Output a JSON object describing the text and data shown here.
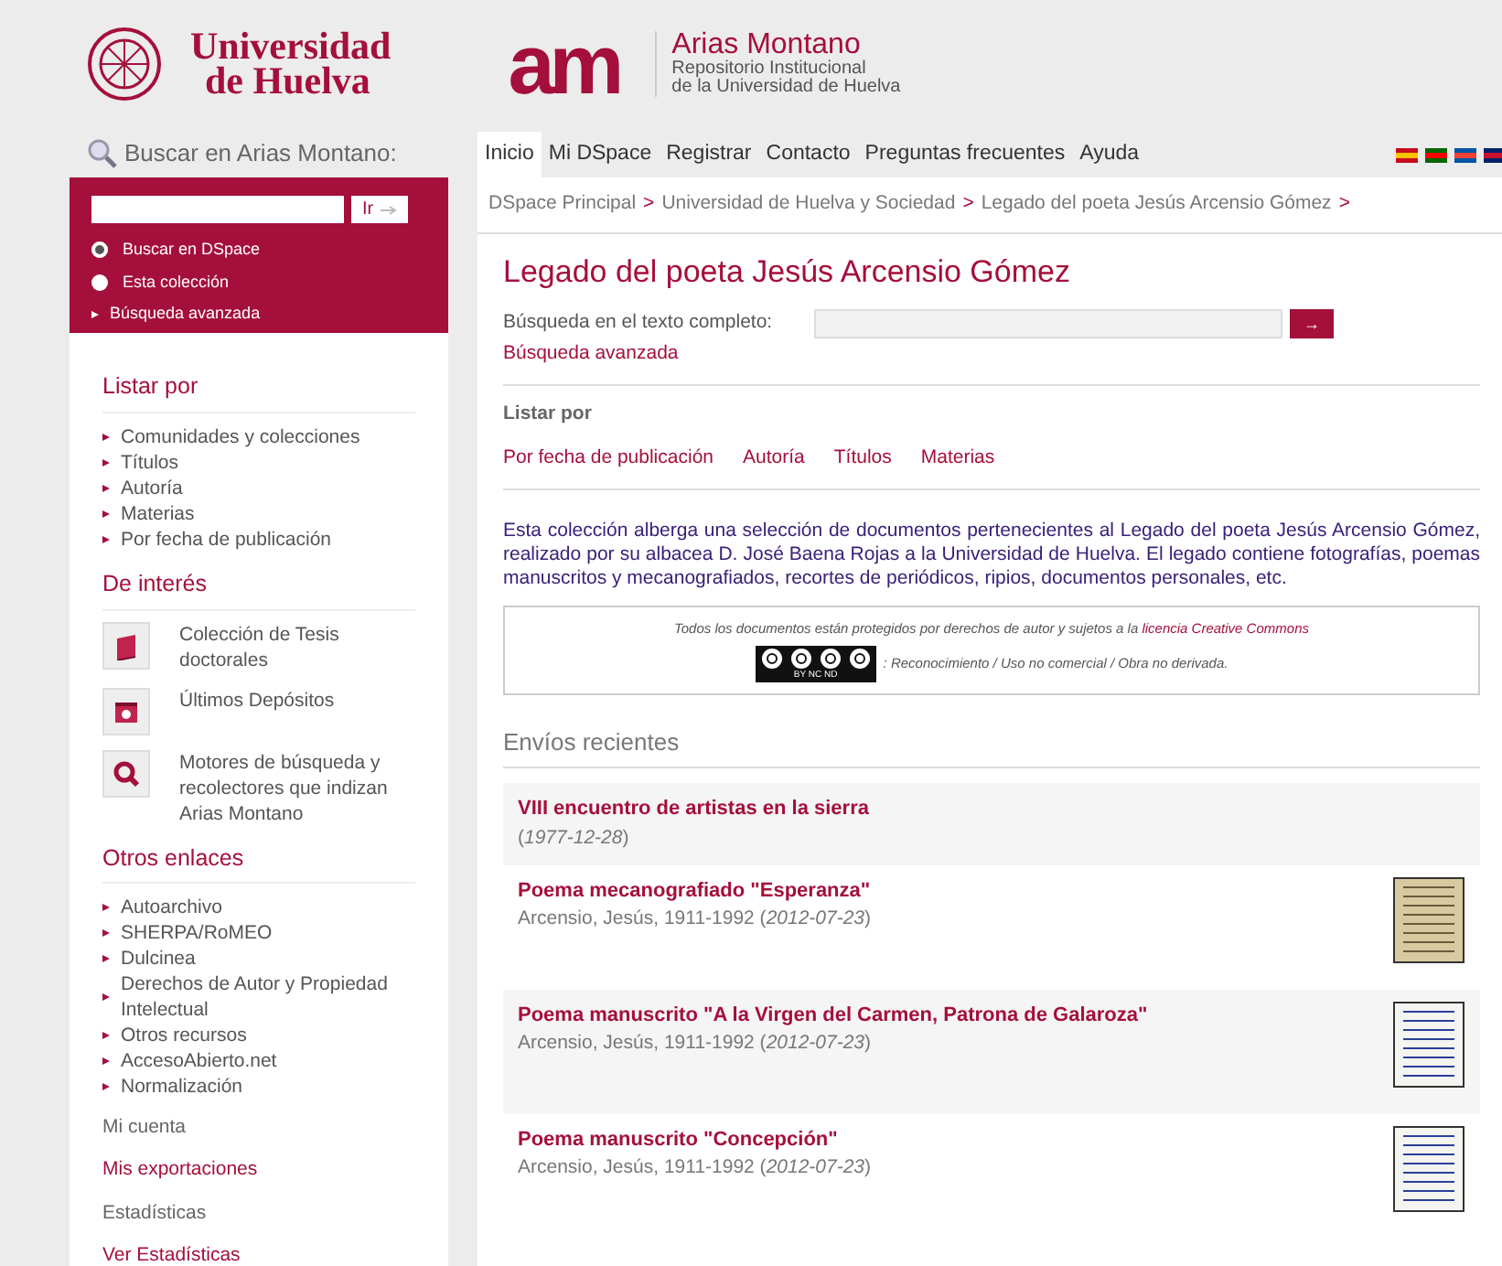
{
  "header": {
    "university": {
      "line1": "Universidad",
      "line2": "de Huelva"
    },
    "repository": {
      "logo_text": "am",
      "name": "Arias Montano",
      "subtitle1": "Repositorio Institucional",
      "subtitle2": "de la Universidad de Huelva"
    }
  },
  "sidebar_search": {
    "title": "Buscar en Arias Montano:",
    "button": "Ir",
    "scopes": [
      {
        "label": "Buscar en DSpace",
        "selected": true
      },
      {
        "label": "Esta colección",
        "selected": false
      }
    ],
    "advanced": "Búsqueda avanzada"
  },
  "nav": {
    "tabs": [
      {
        "label": "Inicio",
        "selected": true
      },
      {
        "label": "Mi DSpace",
        "selected": false
      },
      {
        "label": "Registrar",
        "selected": false
      },
      {
        "label": "Contacto",
        "selected": false
      },
      {
        "label": "Preguntas frecuentes",
        "selected": false
      },
      {
        "label": "Ayuda",
        "selected": false
      }
    ]
  },
  "sidebar": {
    "browse": {
      "title": "Listar por",
      "items": [
        "Comunidades y colecciones",
        "Títulos",
        "Autoría",
        "Materias",
        "Por fecha de publicación"
      ]
    },
    "interest": {
      "title": "De interés",
      "items": [
        {
          "kind": "book",
          "label": "Colección de Tesis doctorales"
        },
        {
          "kind": "deposit",
          "label": "Últimos Depósitos"
        },
        {
          "kind": "search",
          "label": "Motores de búsqueda y recolectores que indizan Arias Montano"
        }
      ]
    },
    "links": {
      "title": "Otros enlaces",
      "items": [
        "Autoarchivo",
        "SHERPA/RoMEO",
        "Dulcinea",
        "Derechos de Autor y Propiedad Intelectual",
        "Otros recursos",
        "AccesoAbierto.net",
        "Normalización"
      ]
    },
    "account": {
      "title": "Mi cuenta",
      "link": "Mis exportaciones"
    },
    "stats": {
      "title": "Estadísticas",
      "link": "Ver Estadísticas"
    }
  },
  "breadcrumb": [
    "DSpace Principal",
    "Universidad de Huelva y Sociedad",
    "Legado del poeta Jesús Arcensio Gómez"
  ],
  "breadcrumb_separator": ">",
  "collection": {
    "title": "Legado del poeta Jesús Arcensio Gómez",
    "search_label": "Búsqueda en el texto completo:",
    "search_button": "→",
    "advanced": "Búsqueda avanzada",
    "browse_title": "Listar por",
    "browse_links": [
      "Por fecha de publicación",
      "Autoría",
      "Títulos",
      "Materias"
    ],
    "description": "Esta colección alberga una selección de documentos pertenecientes al Legado del poeta Jesús Arcensio Gómez, realizado por su albacea D. José Baena Rojas a la Universidad de Huelva. El legado contiene fotografías, poemas manuscritos y mecanografiados, recortes de periódicos, ripios, documentos personales, etc.",
    "license_text": "Todos los documentos están protegidos por derechos de autor y sujetos a la",
    "license_link": "licencia Creative Commons",
    "license_badge": "BY NC ND",
    "license_terms": ": Reconocimiento / Uso no comercial / Obra no derivada."
  },
  "recent": {
    "title": "Envíos recientes",
    "items": [
      {
        "kind": "text",
        "title": "VIII encuentro de artistas en la sierra",
        "meta": "(*1977-12-28*)"
      },
      {
        "kind": "typed",
        "title": "Poema mecanografiado \"Esperanza\"",
        "meta": "Arcensio, Jesús, 1911-1992 (*2012-07-23*)"
      },
      {
        "kind": "handwritten",
        "title": "Poema manuscrito \"A la Virgen del Carmen, Patrona de Galaroza\"",
        "meta": "Arcensio, Jesús, 1911-1992 (*2012-07-23*)"
      },
      {
        "kind": "handwritten",
        "title": "Poema manuscrito \"Concepción\"",
        "meta": "Arcensio, Jesús, 1911-1992 (*2012-07-23*)"
      }
    ]
  }
}
